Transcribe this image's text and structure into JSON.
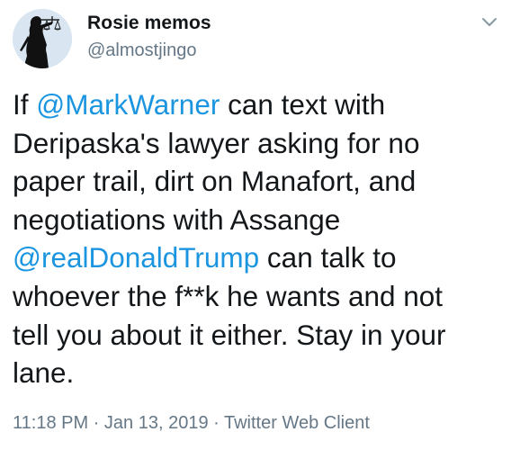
{
  "author": {
    "display_name": "Rosie memos",
    "handle": "@almostjingo"
  },
  "tweet": {
    "line1_pre": "If ",
    "mention1": "@MarkWarner",
    "line1_post": " can text with",
    "line2": "Deripaska's lawyer asking for no",
    "line3": "paper trail, dirt on Manafort, and",
    "line4": "negotiations with Assange",
    "mention2": "@realDonaldTrump",
    "line5_post": " can talk to",
    "line6": "whoever the f**k he wants and not",
    "line7": "tell you about it either. Stay in your",
    "line8": "lane."
  },
  "meta": {
    "time": "11:18 PM",
    "separator": " · ",
    "date": "Jan 13, 2019",
    "source": "Twitter Web Client"
  },
  "colors": {
    "link": "#1b95e0",
    "text": "#14171a",
    "muted": "#657786"
  },
  "icons": {
    "avatar": "lady-justice-silhouette",
    "menu": "chevron-down-icon"
  }
}
